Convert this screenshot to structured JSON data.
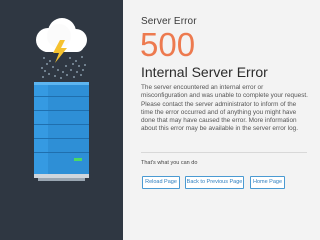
{
  "error": {
    "label": "Server Error",
    "code": "500",
    "title": "Internal Server Error",
    "description": "The server encountered an internal error or misconfiguration and was unable to complete your request. Please contact the server administrator to inform of the time the error occurred and of anything you might have done that may have caused the error. More information about this error may be available in the server error log."
  },
  "actions": {
    "label": "That's what you can do",
    "buttons": [
      "Reload Page",
      "Back to Previous Page",
      "Home Page"
    ]
  },
  "colors": {
    "left_panel": "#2f3742",
    "accent_orange": "#ed7a4f",
    "button_blue": "#4a9ad2",
    "server_blue": "#2e8fd6",
    "cloud_white": "#ffffff",
    "lightning_yellow": "#f5c12e",
    "led_green": "#4cd964"
  },
  "icons": [
    "cloud-icon",
    "lightning-icon",
    "rain-icon",
    "server-icon"
  ]
}
